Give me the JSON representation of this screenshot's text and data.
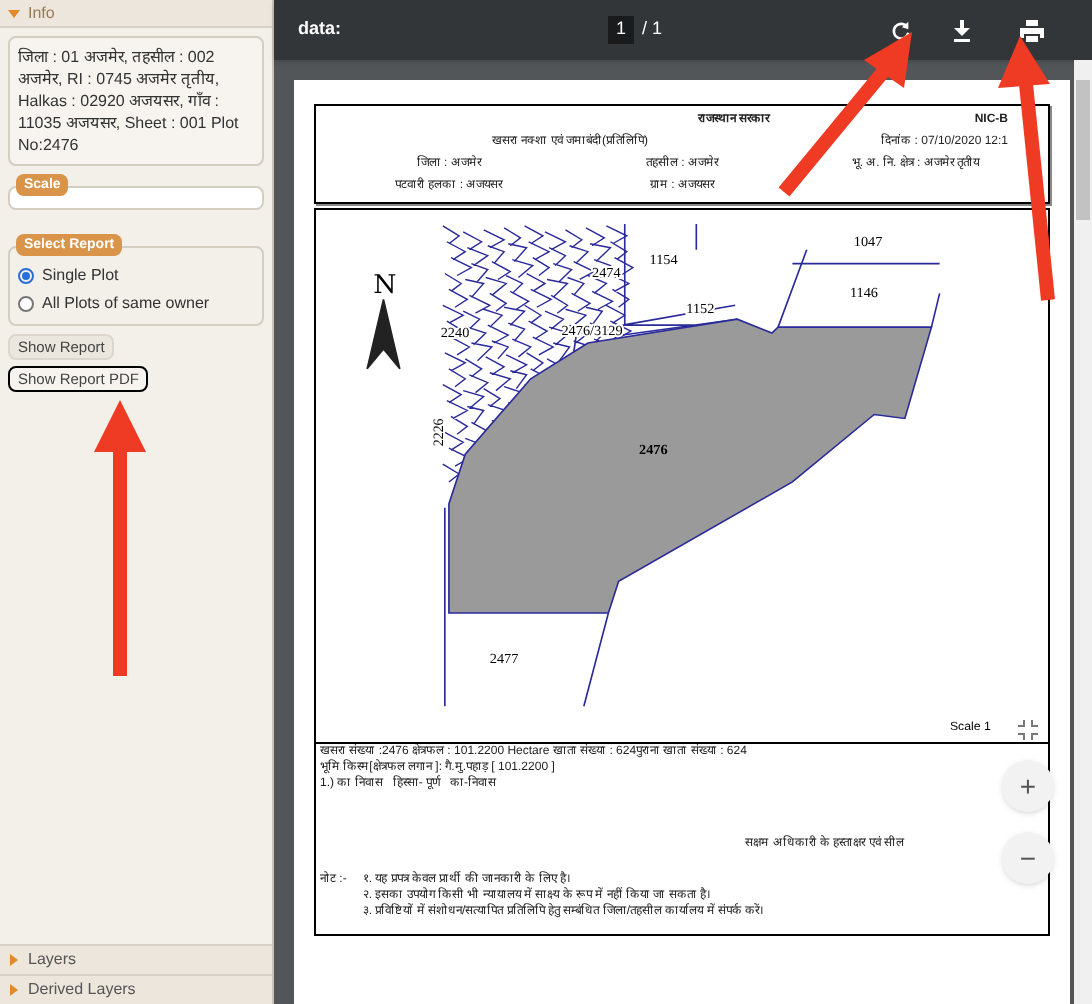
{
  "sidebar": {
    "info": {
      "label": "Info",
      "expanded": true
    },
    "info_text": "जिला : 01 अजमेर, तहसील : 002 अजमेर, RI : 0745 अजमेर तृतीय, Halkas : 02920 अजयसर, गाँव : 11035 अजयसर, Sheet : 001 Plot No:2476",
    "scale_legend": "Scale",
    "report_legend": "Select Report",
    "report_options": [
      {
        "label": "Single Plot",
        "selected": true
      },
      {
        "label": "All Plots of same owner",
        "selected": false
      }
    ],
    "buttons": [
      {
        "label": "Show Report",
        "focused": false
      },
      {
        "label": "Show Report PDF",
        "focused": true
      }
    ],
    "panels": [
      {
        "label": "Layers",
        "expanded": false
      },
      {
        "label": "Derived Layers",
        "expanded": false
      }
    ]
  },
  "viewer": {
    "title": "data:",
    "page": "1",
    "page_total": "/ 1"
  },
  "document": {
    "header": {
      "government": "राजस्थान सरकार",
      "code": "NIC-B",
      "subtitle": "खसरा नक्शा एवं जमाबंदी(प्रतिलिपि)",
      "date": "दिनांक : 07/10/2020 12:1",
      "fields": [
        [
          "जिला : अजमेर",
          "तहसील : अजमेर",
          "भू. अ. नि. क्षेत्र : अजमेर तृतीय"
        ],
        [
          "पटवारी हलका : अजयसर",
          "ग्राम : अजयसर"
        ]
      ]
    },
    "map": {
      "north": "N",
      "scale": "Scale 1",
      "labels": [
        {
          "text": "1154",
          "kind": "plot"
        },
        {
          "text": "1047",
          "kind": "plot"
        },
        {
          "text": "1146",
          "kind": "plot"
        },
        {
          "text": "1152",
          "kind": "plot"
        },
        {
          "text": "2474",
          "kind": "plot"
        },
        {
          "text": "2476/3129",
          "kind": "plot"
        },
        {
          "text": "2240",
          "kind": "plot"
        },
        {
          "text": "2226",
          "kind": "rotated"
        },
        {
          "text": "2476",
          "kind": "selected"
        },
        {
          "text": "2477",
          "kind": "plot"
        }
      ]
    },
    "details": [
      "खसरा संख्या :2476 क्षेत्रफल : 101.2200 Hectare खाता संख्या : 624पुराना खाता संख्या : 624",
      "भूमि किस्म[क्षेत्रफल लगान ]: गै.मु.पहाड़ [ 101.2200 ]",
      "1.) का निवास   हिस्सा- पूर्ण   का-निवास"
    ],
    "signature": "सक्षम अधिकारी के हस्ताक्षर एवं सील",
    "note_label": "नोट :-",
    "notes": [
      "१. यह प्रपत्र केवल प्रार्थी की जानकारी के लिए है।",
      "२. इसका उपयोग किसी भी न्यायालय में साक्ष्य के रूप में नहीं किया जा सकता है।",
      "३. प्रविष्टियों में संशोधन/सत्यापित प्रतिलिपि हेतु सम्बंधित जिला/तहसील कार्यालय में संपर्क करें।"
    ]
  },
  "zoom_controls": [
    "+",
    "−"
  ]
}
